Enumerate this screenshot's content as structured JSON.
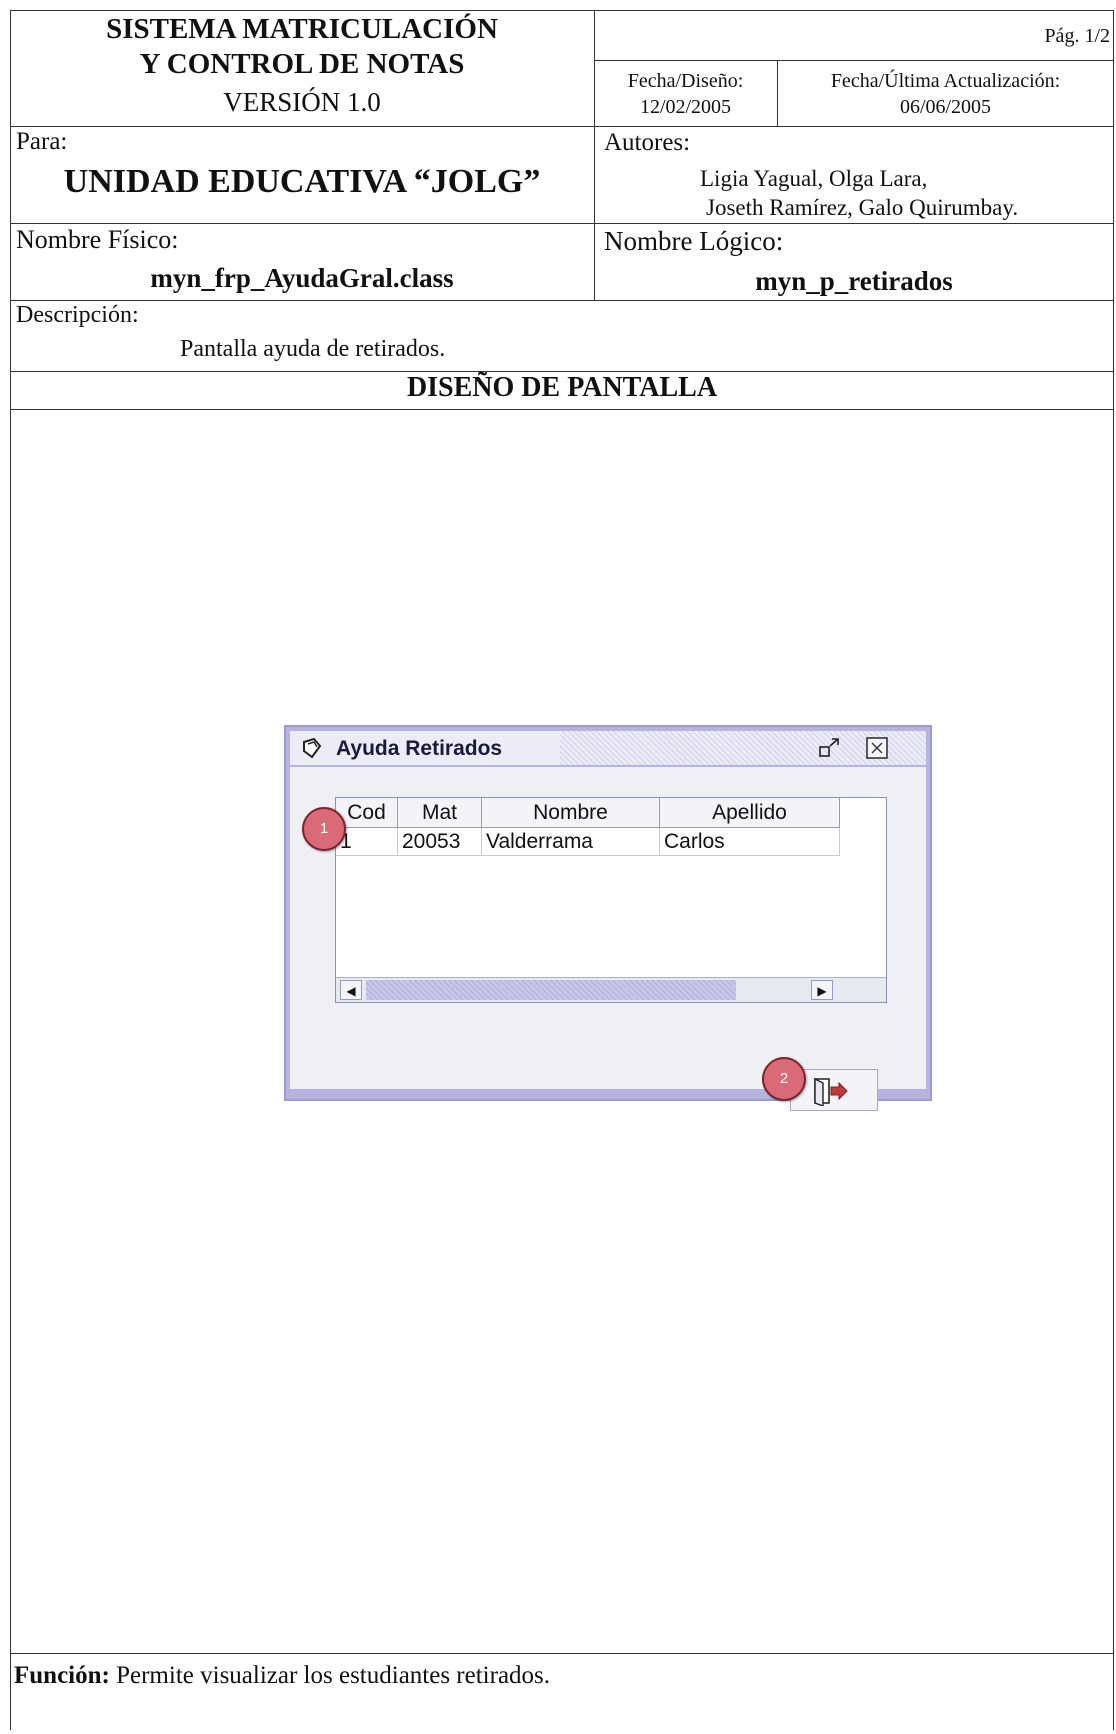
{
  "header": {
    "system_line1": "SISTEMA MATRICULACIÓN",
    "system_line2": "Y CONTROL DE NOTAS",
    "version": "VERSIÓN 1.0",
    "page": "Pág. 1/2",
    "design_date_label": "Fecha/Diseño:",
    "design_date": "12/02/2005",
    "update_date_label": "Fecha/Última Actualización:",
    "update_date": "06/06/2005"
  },
  "recipient": {
    "label": "Para:",
    "value": "UNIDAD EDUCATIVA “JOLG”"
  },
  "authors": {
    "label": "Autores:",
    "line1": "Ligia Yagual, Olga Lara,",
    "line2": "Joseth Ramírez, Galo Quirumbay."
  },
  "physical_name": {
    "label": "Nombre Físico:",
    "value": "myn_frp_AyudaGral.class"
  },
  "logical_name": {
    "label": "Nombre Lógico:",
    "value": "myn_p_retirados"
  },
  "description": {
    "label": "Descripción:",
    "value": "Pantalla ayuda de retirados."
  },
  "section_title": "DISEÑO DE PANTALLA",
  "window": {
    "title": "Ayuda Retirados",
    "columns": [
      "Cod",
      "Mat",
      "Nombre",
      "Apellido"
    ],
    "rows": [
      {
        "cod": "1",
        "mat": "20053",
        "nombre": "Valderrama",
        "apellido": "Carlos"
      }
    ],
    "markers": [
      "1",
      "2"
    ],
    "icons": {
      "window": "window-icon",
      "maximize": "maximize-icon",
      "close": "close-icon",
      "exit": "exit-door-icon"
    }
  },
  "function": {
    "label": "Función:",
    "value": "Permite visualizar los estudiantes retirados."
  }
}
